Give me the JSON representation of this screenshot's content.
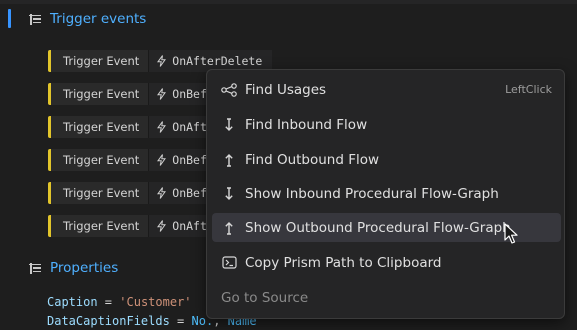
{
  "sections": {
    "trigger_title": "Trigger events",
    "properties_title": "Properties"
  },
  "triggers": [
    {
      "kind": "Trigger Event",
      "name": "OnAfterDelete"
    },
    {
      "kind": "Trigger Event",
      "name": "OnBefo"
    },
    {
      "kind": "Trigger Event",
      "name": "OnAfte"
    },
    {
      "kind": "Trigger Event",
      "name": "OnBefo"
    },
    {
      "kind": "Trigger Event",
      "name": "OnBefo"
    },
    {
      "kind": "Trigger Event",
      "name": "OnAfte"
    }
  ],
  "properties_code": {
    "line1": {
      "key": "Caption",
      "op": " = ",
      "value": "'Customer'"
    },
    "line2": {
      "key": "DataCaptionFields",
      "op": " = ",
      "v1": "No.",
      "sep": ", ",
      "v2": "Name"
    }
  },
  "context_menu": {
    "items": [
      {
        "label": "Find Usages",
        "shortcut": "LeftClick",
        "icon": "share-nodes-icon"
      },
      {
        "label": "Find Inbound Flow",
        "icon": "arrow-down-icon"
      },
      {
        "label": "Find Outbound Flow",
        "icon": "arrow-up-icon"
      },
      {
        "label": "Show Inbound Procedural Flow-Graph",
        "icon": "arrow-down-icon"
      },
      {
        "label": "Show Outbound Procedural Flow-Graph",
        "icon": "arrow-up-icon",
        "hovered": true
      },
      {
        "label": "Copy Prism Path to Clipboard",
        "icon": "terminal-clipboard-icon"
      },
      {
        "label": "Go to Source",
        "disabled": true
      }
    ]
  },
  "colors": {
    "accent_blue": "#4fb0ff",
    "trigger_marker": "#e2c52b",
    "menu_bg": "#252526",
    "menu_hover": "#37373d"
  }
}
